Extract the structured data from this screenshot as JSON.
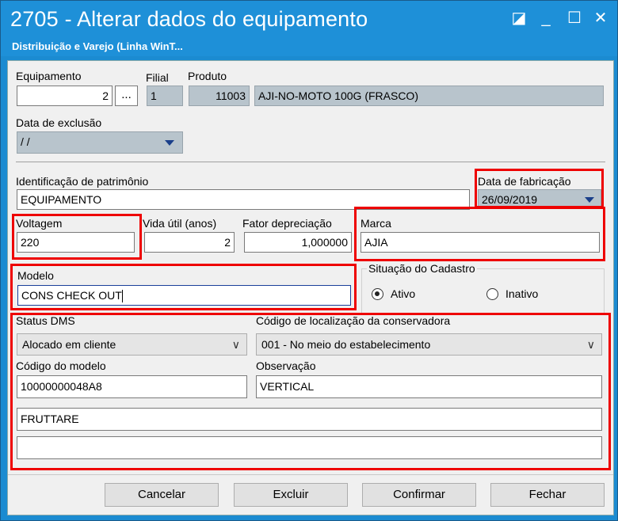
{
  "window": {
    "title": "2705 - Alterar dados do equipamento",
    "subtitle": "Distribuição e Varejo (Linha WinT...",
    "restore_glyph": "◪",
    "minimize_glyph": "_",
    "maximize_glyph": "☐",
    "close_glyph": "✕"
  },
  "equipamento": {
    "label": "Equipamento",
    "value": "2",
    "lookup_label": "..."
  },
  "filial": {
    "label": "Filial",
    "value": "1"
  },
  "produto": {
    "label": "Produto",
    "code": "11003",
    "description": "AJI-NO-MOTO 100G (FRASCO)"
  },
  "data_exclusao": {
    "label": "Data de exclusão",
    "value": " / /"
  },
  "patrimonio": {
    "label": "Identificação de patrimônio",
    "value": "EQUIPAMENTO"
  },
  "data_fabricacao": {
    "label": "Data de fabricação",
    "value": "26/09/2019"
  },
  "voltagem": {
    "label": "Voltagem",
    "value": "220"
  },
  "vida_util": {
    "label": "Vida útil (anos)",
    "value": "2"
  },
  "fator": {
    "label": "Fator depreciação",
    "value": "1,000000"
  },
  "marca": {
    "label": "Marca",
    "value": "AJIA"
  },
  "situacao": {
    "label": "Situação do Cadastro",
    "ativo_label": "Ativo",
    "inativo_label": "Inativo",
    "selected": "Ativo"
  },
  "modelo": {
    "label": "Modelo",
    "value": "CONS CHECK OUT"
  },
  "status_dms": {
    "label": "Status DMS",
    "value": "Alocado em cliente"
  },
  "localizacao": {
    "label": "Código de localização da conservadora",
    "value": "001 - No meio do estabelecimento"
  },
  "codigo_modelo": {
    "label": "Código do modelo",
    "value": "10000000048A8"
  },
  "observacao": {
    "label": "Observação",
    "value": "VERTICAL"
  },
  "extra1": {
    "value": "FRUTTARE"
  },
  "extra2": {
    "value": ""
  },
  "buttons": {
    "cancelar": "Cancelar",
    "excluir": "Excluir",
    "confirmar": "Confirmar",
    "fechar": "Fechar"
  },
  "colors": {
    "titlebar": "#1e90d8",
    "highlight": "#e00000",
    "readonly": "#b8c4cc"
  }
}
